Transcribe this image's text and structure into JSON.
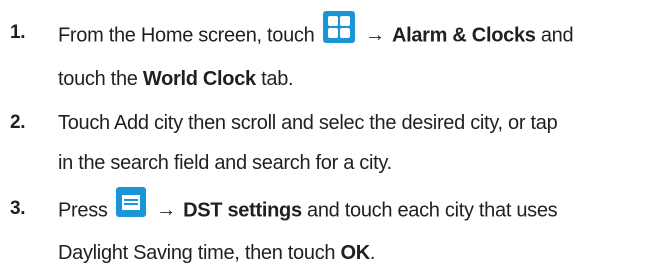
{
  "steps": [
    {
      "number": "1.",
      "pre_icon": "From the Home screen, touch",
      "icon": "apps-grid-icon",
      "arrow": "→",
      "bold_1": "Alarm & Clocks",
      "mid_1": "and",
      "line2_pre": "touch the",
      "bold_2": "World Clock",
      "line2_post": "tab."
    },
    {
      "number": "2.",
      "line1": "Touch Add city then scroll and selec the desired city, or tap",
      "line2": "in the search field and search for a city."
    },
    {
      "number": "3.",
      "pre_icon": "Press",
      "icon": "menu-key-icon",
      "arrow": "→",
      "bold_1": "DST settings",
      "mid_1": "and touch each city that uses",
      "line2_pre": "Daylight Saving time, then touch",
      "bold_2": "OK",
      "line2_post": "."
    }
  ],
  "colors": {
    "text": "#231f20",
    "icon_blue": "#1a95d6"
  }
}
